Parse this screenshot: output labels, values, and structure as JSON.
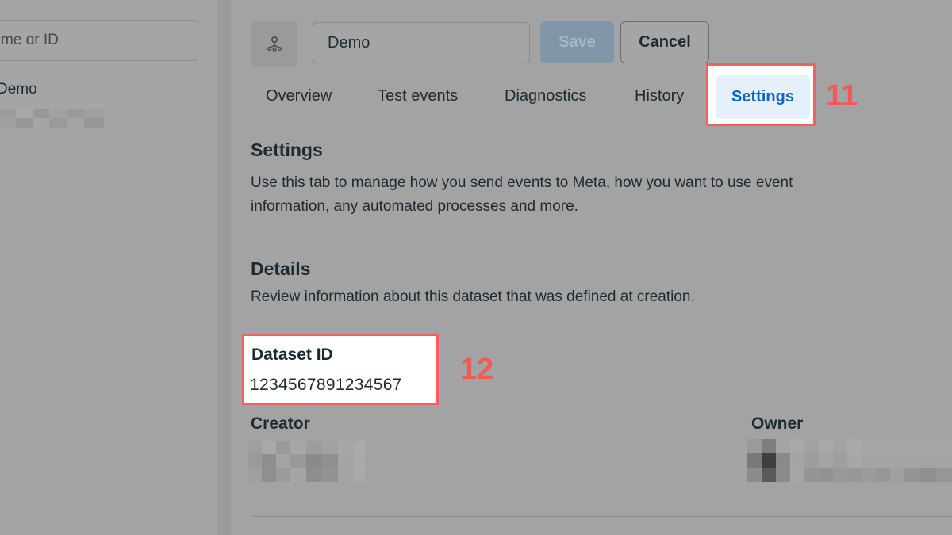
{
  "left_panel": {
    "search_placeholder": "me or ID",
    "list_item_name": "Demo"
  },
  "header": {
    "dataset_name_value": "Demo",
    "dataset_icon": "people-network-icon",
    "save_label": "Save",
    "cancel_label": "Cancel"
  },
  "tabs": [
    {
      "label": "Overview"
    },
    {
      "label": "Test events"
    },
    {
      "label": "Diagnostics"
    },
    {
      "label": "History"
    },
    {
      "label": "Settings",
      "selected": true
    }
  ],
  "callouts": {
    "first": "11",
    "second": "12"
  },
  "settings": {
    "title": "Settings",
    "description_line1": "Use this tab to manage how you send events to Meta, how you want to use event",
    "description_line2": "information, any automated processes and more."
  },
  "details": {
    "title": "Details",
    "description": "Review information about this dataset that was defined at creation.",
    "dataset_id_label": "Dataset ID",
    "dataset_id_value": "1234567891234567",
    "creator_label": "Creator",
    "owner_label": "Owner"
  },
  "colors": {
    "accent": "#0a66c2",
    "highlight_border": "#f06160",
    "callout_text": "#f05a57",
    "overlay_background": "#a3a3a3"
  }
}
